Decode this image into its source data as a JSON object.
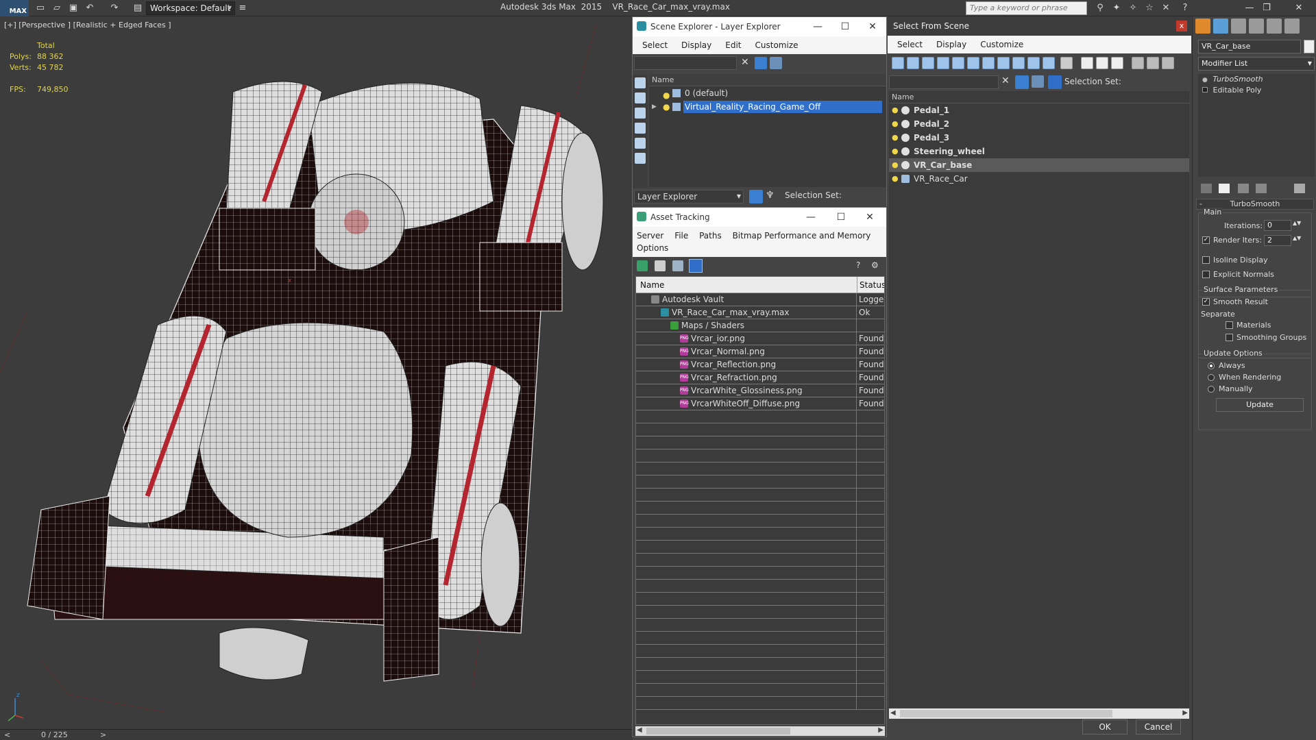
{
  "titlebar": {
    "app_logo": "MAX",
    "workspace_label": "Workspace: Default",
    "app_title": "Autodesk 3ds Max  2015    VR_Race_Car_max_vray.max",
    "search_placeholder": "Type a keyword or phrase"
  },
  "viewport": {
    "label": "[+] [Perspective ] [Realistic + Edged Faces ]",
    "stats": {
      "total_label": "Total",
      "polys_label": "Polys:",
      "polys_value": "88 362",
      "verts_label": "Verts:",
      "verts_value": "45 782",
      "fps_label": "FPS:",
      "fps_value": "749,850"
    },
    "axis_z": "z",
    "axis_x": "x"
  },
  "timebar": {
    "frames": "0 / 225",
    "prev": "<",
    "next": ">"
  },
  "scene_explorer": {
    "title": "Scene Explorer - Layer Explorer",
    "menu": [
      "Select",
      "Display",
      "Edit",
      "Customize"
    ],
    "col_name": "Name",
    "layers": [
      {
        "label": "0 (default)",
        "selected": false
      },
      {
        "label": "Virtual_Reality_Racing_Game_Off",
        "selected": true
      }
    ],
    "footer_dropdown": "Layer Explorer",
    "footer_selection_set": "Selection Set:"
  },
  "asset_tracking": {
    "title": "Asset Tracking",
    "menu_line1": [
      "Server",
      "File",
      "Paths",
      "Bitmap Performance and Memory"
    ],
    "menu_line2": [
      "Options"
    ],
    "col_name": "Name",
    "col_status": "Status",
    "rows": [
      {
        "name": "Autodesk Vault",
        "status": "Logged",
        "indent": 1,
        "icon": "vault-icon"
      },
      {
        "name": "VR_Race_Car_max_vray.max",
        "status": "Ok",
        "indent": 2,
        "icon": "max-file-icon"
      },
      {
        "name": "Maps / Shaders",
        "status": "",
        "indent": 3,
        "icon": "maps-folder-icon"
      },
      {
        "name": "Vrcar_ior.png",
        "status": "Found",
        "indent": 4,
        "icon": "png-icon"
      },
      {
        "name": "Vrcar_Normal.png",
        "status": "Found",
        "indent": 4,
        "icon": "png-icon"
      },
      {
        "name": "Vrcar_Reflection.png",
        "status": "Found",
        "indent": 4,
        "icon": "png-icon"
      },
      {
        "name": "Vrcar_Refraction.png",
        "status": "Found",
        "indent": 4,
        "icon": "png-icon"
      },
      {
        "name": "VrcarWhite_Glossiness.png",
        "status": "Found",
        "indent": 4,
        "icon": "png-icon"
      },
      {
        "name": "VrcarWhiteOff_Diffuse.png",
        "status": "Found",
        "indent": 4,
        "icon": "png-icon"
      }
    ],
    "png_badge": "PNG"
  },
  "select_from_scene": {
    "title": "Select From Scene",
    "close": "x",
    "menu": [
      "Select",
      "Display",
      "Customize"
    ],
    "selection_set_label": "Selection Set:",
    "col_name": "Name",
    "objects": [
      {
        "label": "Pedal_1",
        "selected": false,
        "bold": true
      },
      {
        "label": "Pedal_2",
        "selected": false,
        "bold": true
      },
      {
        "label": "Pedal_3",
        "selected": false,
        "bold": true
      },
      {
        "label": "Steering_wheel",
        "selected": false,
        "bold": true
      },
      {
        "label": "VR_Car_base",
        "selected": true,
        "bold": true
      },
      {
        "label": "VR_Race_Car",
        "selected": false,
        "bold": false
      }
    ],
    "ok_label": "OK",
    "cancel_label": "Cancel"
  },
  "command_panel": {
    "object_name": "VR_Car_base",
    "modifier_list": "Modifier List",
    "stack": [
      "TurboSmooth",
      "Editable Poly"
    ],
    "rollout_title": "TurboSmooth",
    "main_group": "Main",
    "iterations_label": "Iterations:",
    "iterations_value": "0",
    "render_iters_label": "Render Iters:",
    "render_iters_value": "2",
    "render_iters_checked": true,
    "isoline_label": "Isoline Display",
    "explicit_normals_label": "Explicit Normals",
    "surface_group": "Surface Parameters",
    "smooth_result_label": "Smooth Result",
    "separate_label": "Separate",
    "materials_label": "Materials",
    "smoothing_groups_label": "Smoothing Groups",
    "update_group": "Update Options",
    "always_label": "Always",
    "when_rendering_label": "When Rendering",
    "manually_label": "Manually",
    "update_button": "Update"
  },
  "colors": {
    "selection_blue": "#2f6fc9",
    "highlight_row": "#5a5a5a",
    "car_white": "#dedede",
    "car_stripe": "#b3262f",
    "dark_body": "#1b0b0b"
  }
}
